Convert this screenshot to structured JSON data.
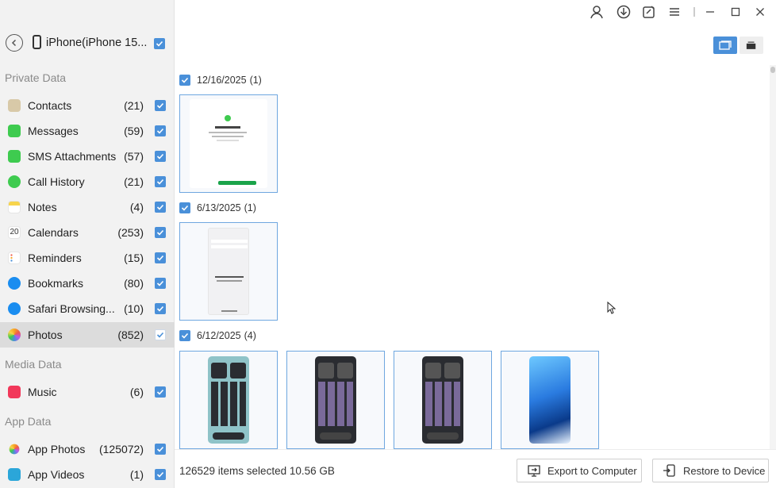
{
  "device": {
    "name": "iPhone(iPhone 15..."
  },
  "sections": {
    "private": "Private Data",
    "media": "Media Data",
    "app": "App Data"
  },
  "nav": {
    "contacts": {
      "label": "Contacts",
      "count": "(21)",
      "icon": "contacts-icon",
      "color": "#c9b48c"
    },
    "messages": {
      "label": "Messages",
      "count": "(59)",
      "icon": "messages-icon",
      "color": "#3ecb4f"
    },
    "sms": {
      "label": "SMS Attachments",
      "count": "(57)",
      "icon": "sms-attachments-icon",
      "color": "#3ecb4f"
    },
    "calls": {
      "label": "Call History",
      "count": "(21)",
      "icon": "phone-icon",
      "color": "#3ecb4f"
    },
    "notes": {
      "label": "Notes",
      "count": "(4)",
      "icon": "notes-icon",
      "color": "#f7d44c"
    },
    "calendars": {
      "label": "Calendars",
      "count": "(253)",
      "icon": "calendar-icon",
      "day": "20"
    },
    "reminders": {
      "label": "Reminders",
      "count": "(15)",
      "icon": "reminders-icon"
    },
    "bookmarks": {
      "label": "Bookmarks",
      "count": "(80)",
      "icon": "safari-icon",
      "color": "#1a8df0"
    },
    "safari": {
      "label": "Safari Browsing...",
      "count": "(10)",
      "icon": "safari-icon",
      "color": "#1a8df0"
    },
    "photos": {
      "label": "Photos",
      "count": "(852)",
      "icon": "photos-icon"
    },
    "music": {
      "label": "Music",
      "count": "(6)",
      "icon": "music-icon",
      "color": "#f2385a"
    },
    "app_photos": {
      "label": "App Photos",
      "count": "(125072)",
      "icon": "app-photos-icon"
    },
    "app_videos": {
      "label": "App Videos",
      "count": "(1)",
      "icon": "app-videos-icon",
      "color": "#2ba6d9"
    }
  },
  "groups": [
    {
      "date": "12/16/2025",
      "count": "(1)"
    },
    {
      "date": "6/13/2025",
      "count": "(1)"
    },
    {
      "date": "6/12/2025",
      "count": "(4)"
    }
  ],
  "status": "126529 items selected 10.56 GB",
  "buttons": {
    "export": "Export to Computer",
    "restore": "Restore to Device"
  },
  "colors": {
    "accent": "#4a90d9",
    "sidebar": "#f2f2f2",
    "active_row": "#dcdcdc"
  }
}
